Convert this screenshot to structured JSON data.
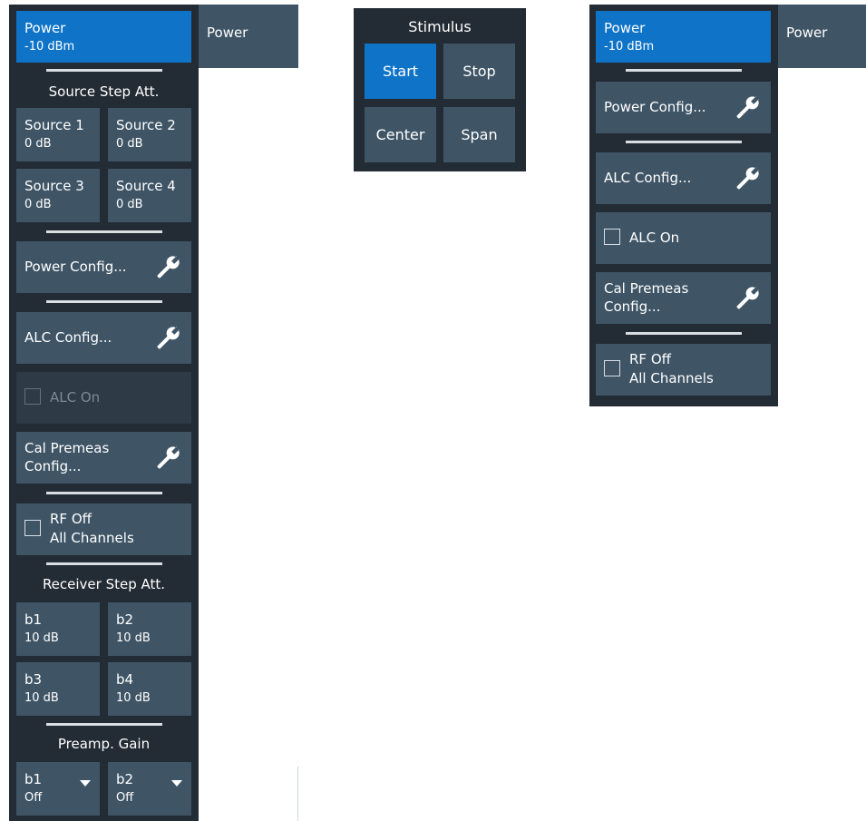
{
  "left_panel": {
    "power": {
      "label": "Power",
      "value": "-10 dBm"
    },
    "tab_label": "Power",
    "source_step_att": {
      "title": "Source Step Att.",
      "items": [
        {
          "label": "Source 1",
          "value": "0 dB"
        },
        {
          "label": "Source 2",
          "value": "0 dB"
        },
        {
          "label": "Source 3",
          "value": "0 dB"
        },
        {
          "label": "Source 4",
          "value": "0 dB"
        }
      ]
    },
    "power_config": "Power Config...",
    "alc_config": "ALC Config...",
    "alc_on": "ALC On",
    "cal_premeas": {
      "line1": "Cal Premeas",
      "line2": "Config..."
    },
    "rf_off": {
      "line1": "RF Off",
      "line2": "All Channels"
    },
    "receiver_step_att": {
      "title": "Receiver Step Att.",
      "items": [
        {
          "label": "b1",
          "value": "10 dB"
        },
        {
          "label": "b2",
          "value": "10 dB"
        },
        {
          "label": "b3",
          "value": "10 dB"
        },
        {
          "label": "b4",
          "value": "10 dB"
        }
      ]
    },
    "preamp_gain": {
      "title": "Preamp. Gain",
      "items": [
        {
          "label": "b1",
          "value": "Off"
        },
        {
          "label": "b2",
          "value": "Off"
        }
      ]
    }
  },
  "stimulus_panel": {
    "title": "Stimulus",
    "buttons": [
      "Start",
      "Stop",
      "Center",
      "Span"
    ]
  },
  "right_panel": {
    "power": {
      "label": "Power",
      "value": "-10 dBm"
    },
    "tab_label": "Power",
    "power_config": "Power Config...",
    "alc_config": "ALC Config...",
    "alc_on": "ALC On",
    "cal_premeas": {
      "line1": "Cal Premeas",
      "line2": "Config..."
    },
    "rf_off": {
      "line1": "RF Off",
      "line2": "All Channels"
    }
  },
  "colors": {
    "panel_bg": "#232b34",
    "button_bg": "#3f5566",
    "active_bg": "#0f74c8",
    "disabled_bg": "#2e3a45",
    "text": "#ffffff"
  },
  "icons": {
    "config": "wrench-icon",
    "dropdown": "caret-down-icon",
    "toggle": "checkbox-icon"
  }
}
